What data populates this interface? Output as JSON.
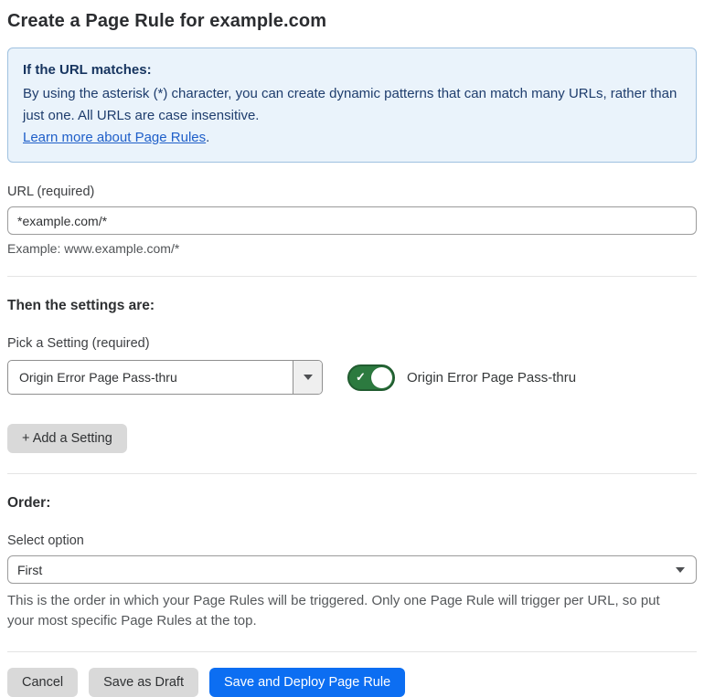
{
  "page": {
    "title": "Create a Page Rule for example.com"
  },
  "info_box": {
    "heading": "If the URL matches:",
    "body": "By using the asterisk (*) character, you can create dynamic patterns that can match many URLs, rather than just one. All URLs are case insensitive.",
    "link_label": "Learn more about Page Rules",
    "link_suffix": "."
  },
  "url_field": {
    "label": "URL (required)",
    "value": "*example.com/*",
    "example": "Example: www.example.com/*"
  },
  "settings_section": {
    "heading": "Then the settings are:",
    "picker_label": "Pick a Setting (required)",
    "picker_value": "Origin Error Page Pass-thru",
    "toggle": {
      "state": "on",
      "check_glyph": "✓",
      "label": "Origin Error Page Pass-thru"
    },
    "add_button_label": "+ Add a Setting"
  },
  "order_section": {
    "heading": "Order:",
    "select_label": "Select option",
    "select_value": "First",
    "help_text": "This is the order in which your Page Rules will be triggered. Only one Page Rule will trigger per URL, so put your most specific Page Rules at the top."
  },
  "footer": {
    "cancel_label": "Cancel",
    "save_draft_label": "Save as Draft",
    "save_deploy_label": "Save and Deploy Page Rule"
  },
  "colors": {
    "accent_blue": "#0c6ef2",
    "toggle_green": "#2c7a3f",
    "toggle_green_border": "#215c30",
    "info_background": "#eaf3fb",
    "info_border": "#9fc1e0",
    "info_text": "#1e3d6d",
    "link_blue": "#1f5fc9",
    "button_gray": "#d9d9d9",
    "divider_gray": "#e4e4e4"
  }
}
